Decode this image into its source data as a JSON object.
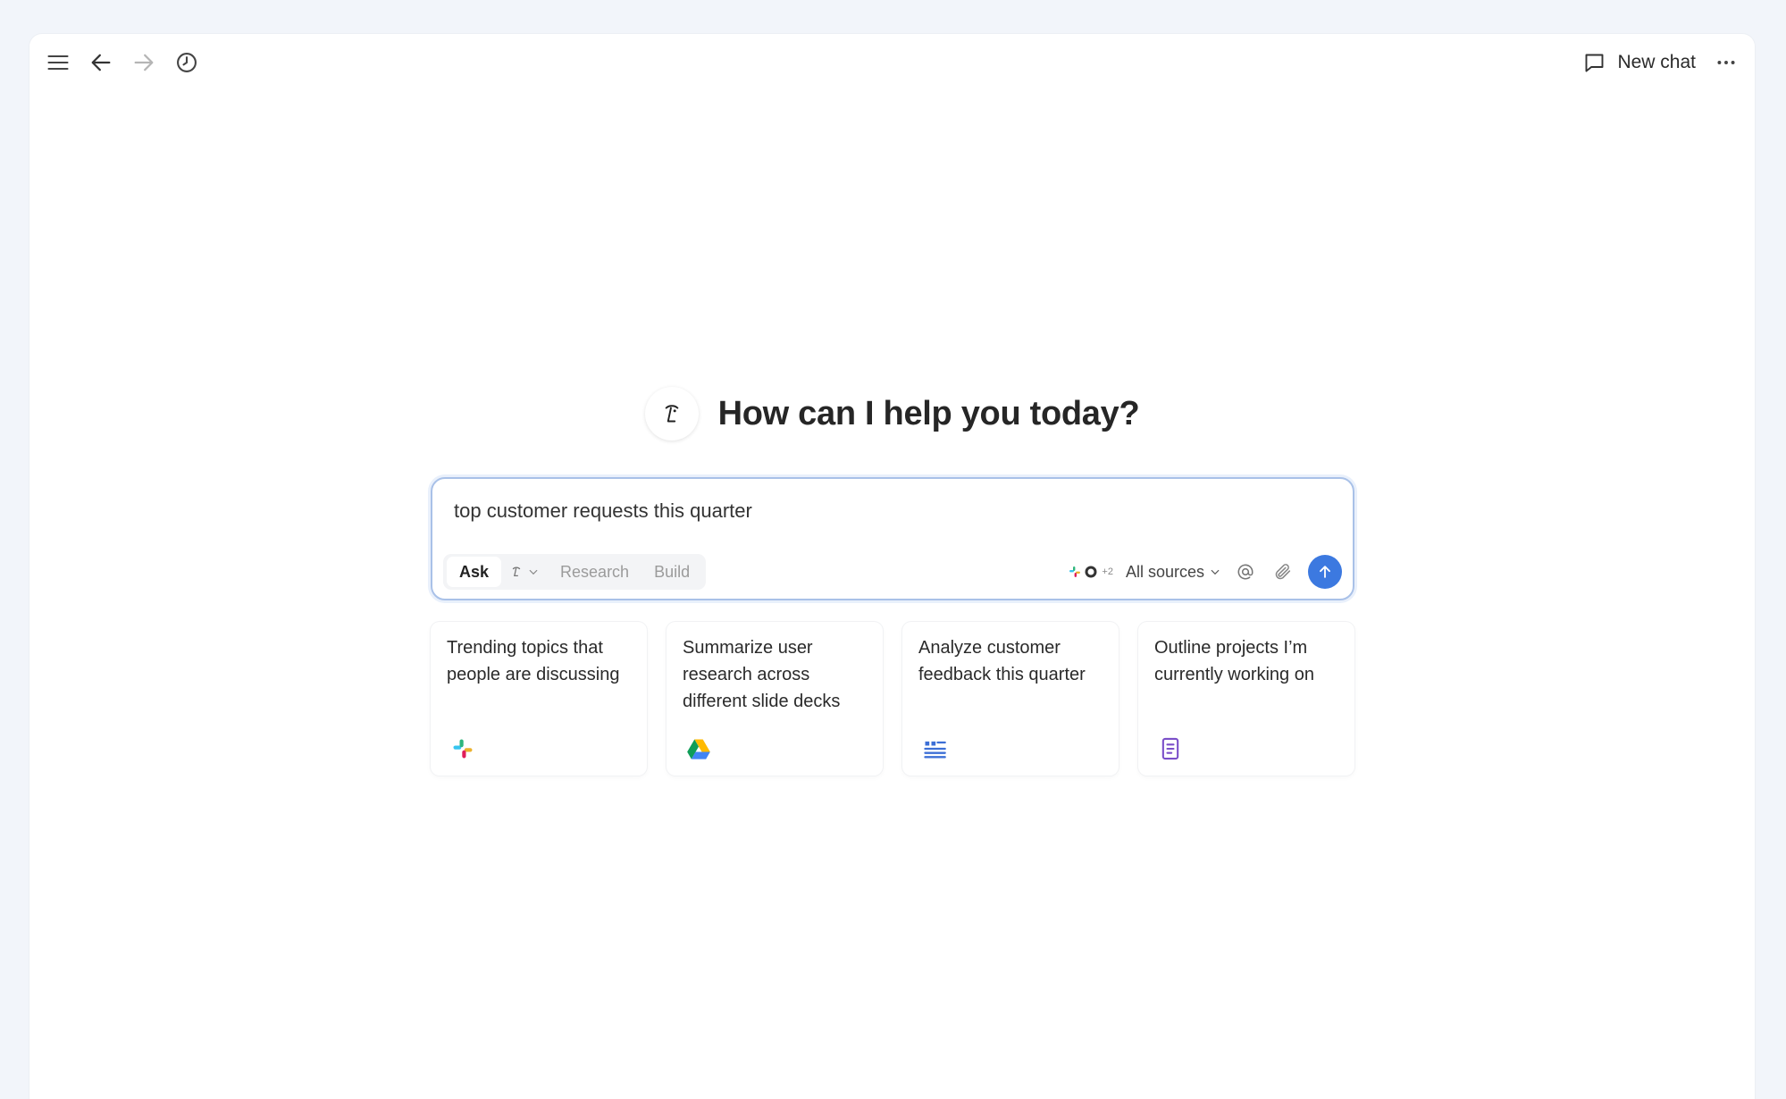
{
  "topbar": {
    "menu_icon": "menu-icon",
    "back_icon": "arrow-left-icon",
    "forward_icon": "arrow-right-icon",
    "history_icon": "clock-icon",
    "new_chat_label": "New chat",
    "more_icon": "more-horizontal-icon"
  },
  "hero": {
    "logo_icon": "assistant-logo-icon",
    "title": "How can I help you today?"
  },
  "composer": {
    "input_value": "top customer requests this quarter",
    "modes": [
      {
        "label": "Ask",
        "active": true
      },
      {
        "label": "Research",
        "active": false
      },
      {
        "label": "Build",
        "active": false
      }
    ],
    "source_extra": "+2",
    "sources_label": "All sources",
    "mention_icon": "at-icon",
    "attach_icon": "paperclip-icon",
    "send_icon": "arrow-up-icon",
    "accent": "#3c79e0"
  },
  "suggestions": [
    {
      "text": "Trending topics that people are discussing",
      "icon": "slack-icon"
    },
    {
      "text": "Summarize user research across different slide decks",
      "icon": "google-drive-icon"
    },
    {
      "text": "Analyze customer feedback this quarter",
      "icon": "quote-list-icon"
    },
    {
      "text": "Outline projects I’m currently working on",
      "icon": "document-icon"
    }
  ]
}
